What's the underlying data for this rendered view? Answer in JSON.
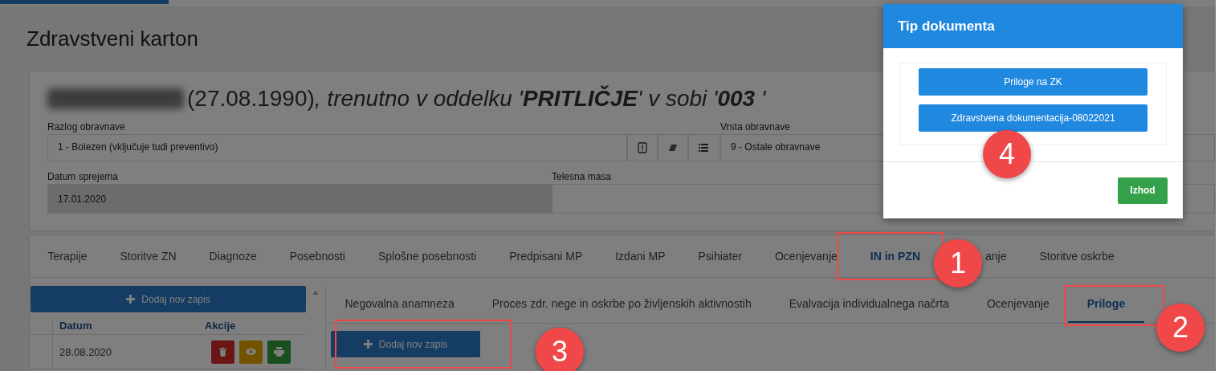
{
  "page": {
    "title": "Zdravstveni karton"
  },
  "heading": [
    {
      "kind": "plain",
      "text": "(27.08.1990)"
    },
    {
      "kind": "italic",
      "text": ", trenutno v oddelku '"
    },
    {
      "kind": "bold-italic",
      "text": "PRITLIČJE"
    },
    {
      "kind": "italic",
      "text": "' v sobi '"
    },
    {
      "kind": "bold-italic",
      "text": "003 "
    },
    {
      "kind": "italic",
      "text": "'"
    }
  ],
  "fields": [
    {
      "label": "Razlog obravnave",
      "value": "1 - Bolezen (vključuje tudi preventivo)",
      "disabled": false
    },
    {
      "label": "Vrsta obravnave",
      "value": "9 - Ostale obravnave",
      "disabled": false
    },
    {
      "label": "Datum sprejema",
      "value": "17.01.2020",
      "disabled": true
    },
    {
      "label": "Telesna masa",
      "disabled": false
    }
  ],
  "tabs": [
    {
      "label": "Terapije",
      "selected": false
    },
    {
      "label": "Storitve ZN",
      "selected": false
    },
    {
      "label": "Diagnoze",
      "selected": false
    },
    {
      "label": "Posebnosti",
      "selected": false
    },
    {
      "label": "Splošne posebnosti",
      "selected": false
    },
    {
      "label": "Predpisani MP",
      "selected": false
    },
    {
      "label": "Izdani MP",
      "selected": false
    },
    {
      "label": "Psihiater",
      "selected": false
    },
    {
      "label": "Ocenjevanje",
      "selected": false
    },
    {
      "label": "IN in PZN",
      "selected": true
    },
    {
      "label": "anje",
      "selected": false
    },
    {
      "label": "Storitve oskrbe",
      "selected": false
    }
  ],
  "left_panel": {
    "add_button": "Dodaj nov zapis",
    "columns": [
      "Datum",
      "Akcije"
    ],
    "rows": [
      {
        "date": "28.08.2020"
      }
    ]
  },
  "subtabs": [
    {
      "label": "Negovalna anamneza",
      "selected": false
    },
    {
      "label": "Proces zdr. nege in oskrbe po življenskih aktivnostih",
      "selected": false
    },
    {
      "label": "Evalvacija individualnega načrta",
      "selected": false
    },
    {
      "label": "Ocenjevanje",
      "selected": false
    },
    {
      "label": "Priloge",
      "selected": true
    }
  ],
  "add_button": "Dodaj nov zapis",
  "modal": {
    "title": "Tip dokumenta",
    "options": [
      "Priloge na ZK",
      "Zdravstvena dokumentacija-08022021"
    ],
    "close_button": "Izhod"
  },
  "annotations": [
    "1",
    "2",
    "3",
    "4"
  ]
}
